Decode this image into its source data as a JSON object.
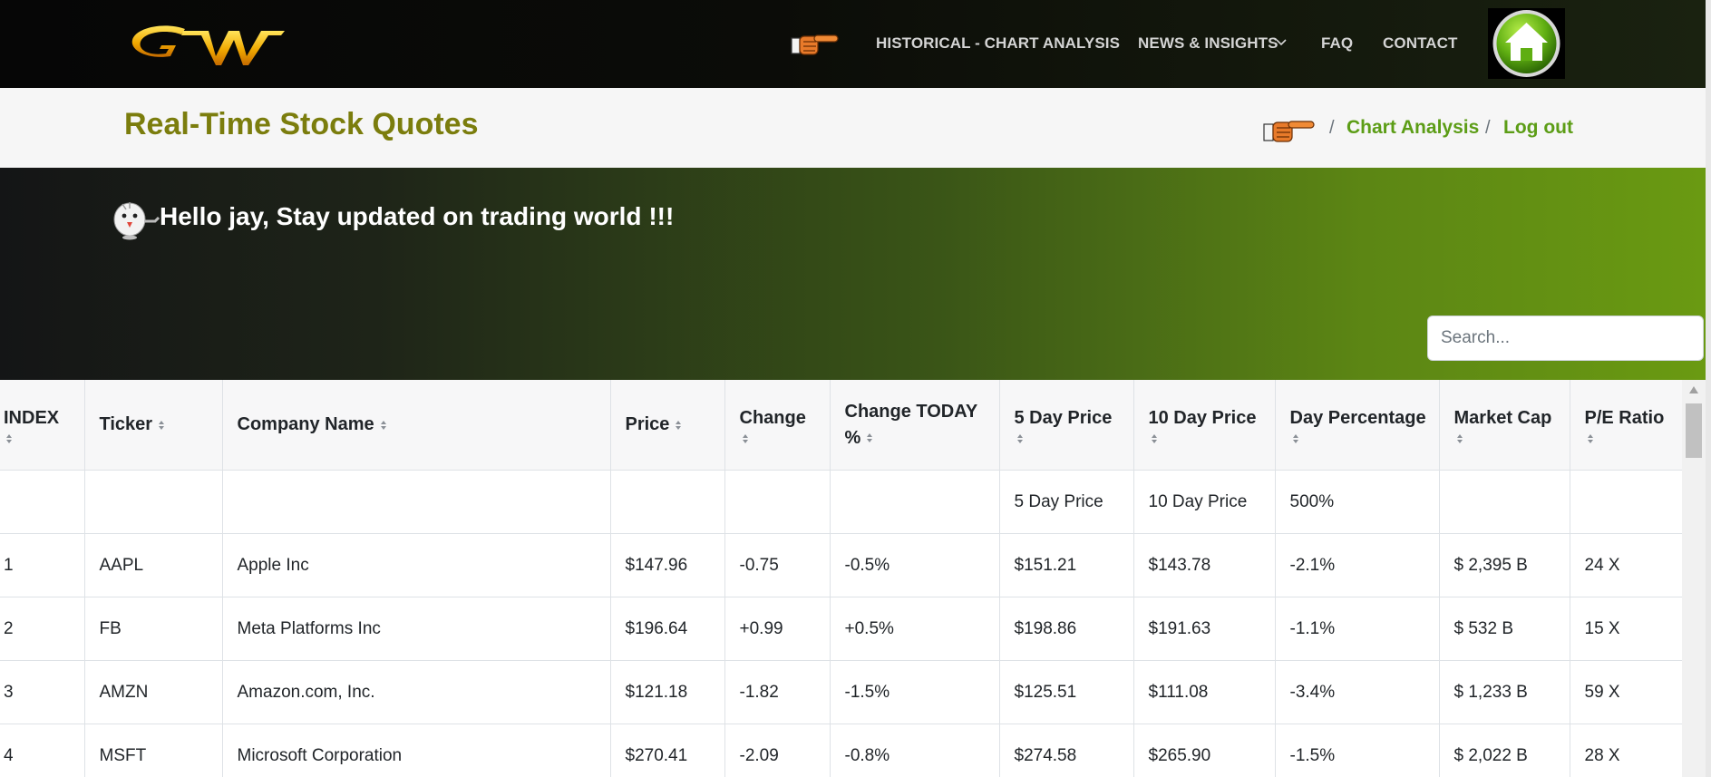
{
  "navbar": {
    "logo_text": "GW",
    "links": {
      "historical": "HISTORICAL - CHART ANALYSIS",
      "news": "NEWS & INSIGHTS",
      "faq": "FAQ",
      "contact": "CONTACT"
    }
  },
  "header": {
    "title": "Real-Time Stock Quotes",
    "breadcrumb": {
      "separator": "/",
      "chart_analysis": "Chart Analysis",
      "logout": "Log out"
    }
  },
  "hero": {
    "greeting": "Hello jay, Stay updated on trading world !!!"
  },
  "search": {
    "placeholder": "Search..."
  },
  "table": {
    "headers": {
      "index": "INDEX",
      "ticker": "Ticker",
      "company": "Company Name",
      "price": "Price",
      "change": "Change",
      "change_today": "Change TODAY %",
      "five_day": "5 Day Price",
      "ten_day": "10 Day Price",
      "day_pct": "Day Percentage",
      "market_cap": "Market Cap",
      "pe": "P/E Ratio"
    },
    "filter_row": {
      "five_day": "5 Day Price",
      "ten_day": "10 Day Price",
      "day_pct": "500%"
    },
    "rows": [
      {
        "index": "1",
        "ticker": "AAPL",
        "company": "Apple Inc",
        "price": "$147.96",
        "change": "-0.75",
        "change_today": "-0.5%",
        "five_day": "$151.21",
        "ten_day": "$143.78",
        "day_pct": "-2.1%",
        "market_cap": "$ 2,395 B",
        "pe": "24 X"
      },
      {
        "index": "2",
        "ticker": "FB",
        "company": "Meta Platforms Inc",
        "price": "$196.64",
        "change": "+0.99",
        "change_today": "+0.5%",
        "five_day": "$198.86",
        "ten_day": "$191.63",
        "day_pct": "-1.1%",
        "market_cap": "$ 532 B",
        "pe": "15 X"
      },
      {
        "index": "3",
        "ticker": "AMZN",
        "company": "Amazon.com, Inc.",
        "price": "$121.18",
        "change": "-1.82",
        "change_today": "-1.5%",
        "five_day": "$125.51",
        "ten_day": "$111.08",
        "day_pct": "-3.4%",
        "market_cap": "$ 1,233 B",
        "pe": "59 X"
      },
      {
        "index": "4",
        "ticker": "MSFT",
        "company": "Microsoft Corporation",
        "price": "$270.41",
        "change": "-2.09",
        "change_today": "-0.8%",
        "five_day": "$274.58",
        "ten_day": "$265.90",
        "day_pct": "-1.5%",
        "market_cap": "$ 2,022 B",
        "pe": "28 X"
      }
    ]
  },
  "colors": {
    "title_olive": "#7b7d0d",
    "link_green": "#5c9d16",
    "nav_text": "#d4d4d4",
    "hero_end": "#6a9a12"
  },
  "icons": {
    "logo": "gw-logo",
    "pointer": "pointing-hand-icon",
    "home": "home-icon",
    "bird": "bird-mascot-icon",
    "sort": "sort-icon",
    "chevron": "chevron-down-icon"
  }
}
